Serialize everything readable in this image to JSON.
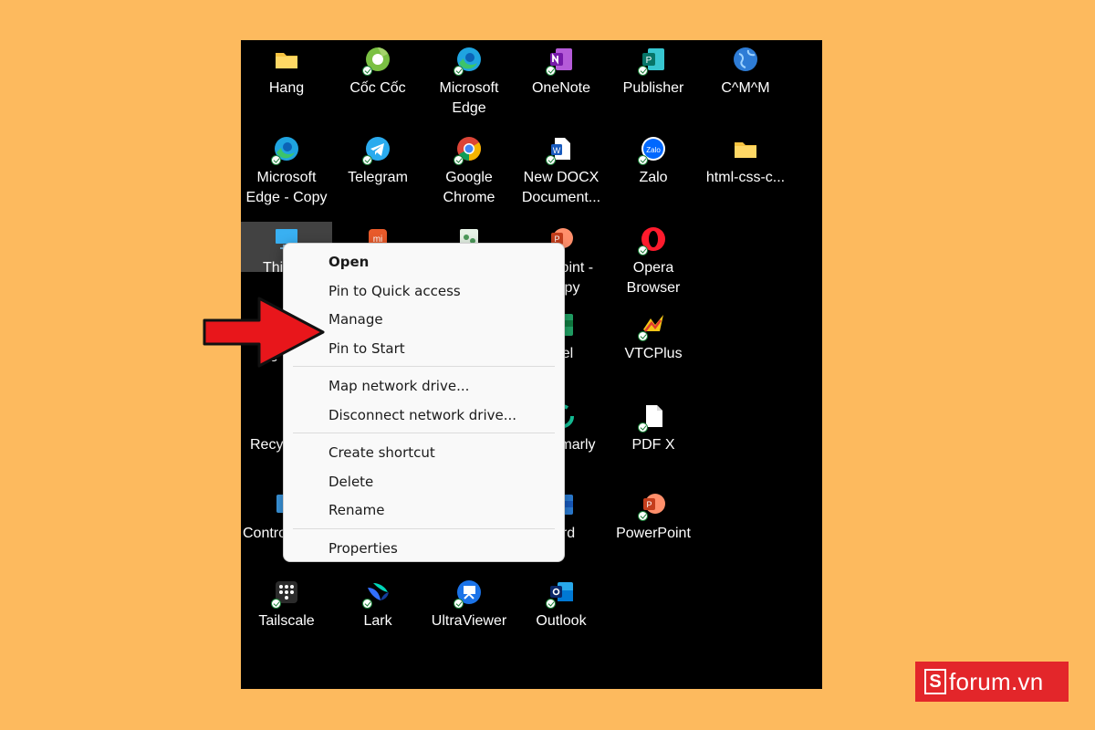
{
  "desktop": {
    "icons": [
      {
        "label": "Hang",
        "icon": "folder-icon"
      },
      {
        "label": "Cốc Cốc",
        "icon": "coccoc-browser-icon"
      },
      {
        "label": "Microsoft\nEdge",
        "icon": "edge-icon"
      },
      {
        "label": "OneNote",
        "icon": "onenote-icon"
      },
      {
        "label": "Publisher",
        "icon": "publisher-icon"
      },
      {
        "label": "C^M^M",
        "icon": "globe-icon"
      },
      {
        "label": "Microsoft\nEdge - Copy",
        "icon": "edge-icon"
      },
      {
        "label": "Telegram",
        "icon": "telegram-icon"
      },
      {
        "label": "Google\nChrome",
        "icon": "chrome-icon"
      },
      {
        "label": "New DOCX\nDocument...",
        "icon": "word-document-icon"
      },
      {
        "label": "Zalo",
        "icon": "zalo-icon"
      },
      {
        "label": "html-css-c...",
        "icon": "folder-icon"
      },
      {
        "label": "Thi",
        "icon": "this-pc-icon"
      },
      {
        "label": "",
        "icon": "mi-app-icon"
      },
      {
        "label": "",
        "icon": "app-icon"
      },
      {
        "label": "Point -\npy",
        "icon": "powerpoint-icon"
      },
      {
        "label": "Opera\nBrowser",
        "icon": "opera-icon"
      },
      {
        "label": "Ne",
        "icon": "network-icon"
      },
      {
        "label": "el",
        "icon": "excel-icon"
      },
      {
        "label": "VTCPlus",
        "icon": "vtcplus-icon"
      },
      {
        "label": "Recyc",
        "icon": "recycle-bin-icon"
      },
      {
        "label": "marly",
        "icon": "grammarly-icon"
      },
      {
        "label": "PDF X",
        "icon": "pdf-file-icon"
      },
      {
        "label": "Contro",
        "icon": "control-panel-icon"
      },
      {
        "label": "rd",
        "icon": "word-icon"
      },
      {
        "label": "PowerPoint",
        "icon": "powerpoint-icon"
      },
      {
        "label": "Tailscale",
        "icon": "tailscale-icon"
      },
      {
        "label": "Lark",
        "icon": "lark-icon"
      },
      {
        "label": "UltraViewer",
        "icon": "ultraviewer-icon"
      },
      {
        "label": "Outlook",
        "icon": "outlook-icon"
      }
    ]
  },
  "context_menu": {
    "items": [
      {
        "label": "Open"
      },
      {
        "label": "Pin to Quick access"
      },
      {
        "label": "Manage"
      },
      {
        "label": "Pin to Start"
      },
      {
        "label": "Map network drive..."
      },
      {
        "label": "Disconnect network drive..."
      },
      {
        "label": "Create shortcut"
      },
      {
        "label": "Delete"
      },
      {
        "label": "Rename"
      },
      {
        "label": "Properties"
      }
    ]
  },
  "annotation": {
    "icon": "red-arrow-icon",
    "color": "#E8161B"
  },
  "watermark": {
    "s": "S",
    "text": "forum.vn",
    "color": "#E3262A"
  },
  "colors": {
    "background": "#FDBA5E",
    "desktop": "#000000",
    "menu": "#F9F9F9"
  }
}
